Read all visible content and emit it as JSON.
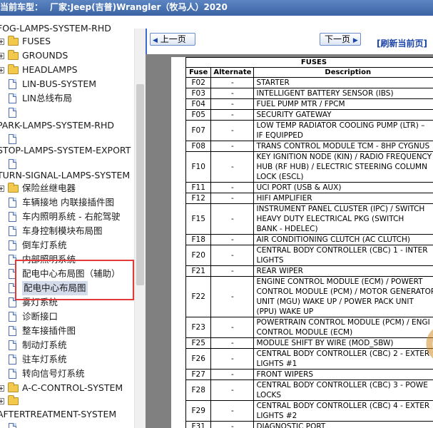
{
  "titlebar": {
    "prefix": "当前车型：",
    "maker": "厂家:Jeep(吉普)Wrangler（牧马人）2020"
  },
  "tree": [
    {
      "label": "FOG-LAMPS-SYSTEM-RHD",
      "type": "text",
      "indent": -2
    },
    {
      "label": "FUSES",
      "type": "folder",
      "indent": 0
    },
    {
      "label": "GROUNDS",
      "type": "folder",
      "indent": 0
    },
    {
      "label": "HEADLAMPS",
      "type": "folder",
      "indent": 0
    },
    {
      "label": "LIN-BUS-SYSTEM",
      "type": "doc",
      "indent": 0
    },
    {
      "label": "LIN总线布局",
      "type": "doc",
      "indent": 0
    },
    {
      "label": "",
      "type": "doc",
      "indent": 0
    },
    {
      "label": "PARK-LAMPS-SYSTEM-RHD",
      "type": "text",
      "indent": -2
    },
    {
      "label": "",
      "type": "doc",
      "indent": 0
    },
    {
      "label": "STOP-LAMPS-SYSTEM-EXPORT",
      "type": "text",
      "indent": -2
    },
    {
      "label": "",
      "type": "doc",
      "indent": 0
    },
    {
      "label": "TURN-SIGNAL-LAMPS-SYSTEM",
      "type": "text",
      "indent": -2
    },
    {
      "label": "保险丝继电器",
      "type": "folder",
      "indent": 0
    },
    {
      "label": "车辆接地 内联接插件图",
      "type": "doc",
      "indent": 0
    },
    {
      "label": "车内照明系统 - 右舵驾驶",
      "type": "doc",
      "indent": 0
    },
    {
      "label": "车身控制模块布局图",
      "type": "doc",
      "indent": 0
    },
    {
      "label": "倒车灯系统",
      "type": "doc",
      "indent": 0
    },
    {
      "label": "内部照明系统",
      "type": "doc",
      "indent": 0
    },
    {
      "label": "配电中心布局图（辅助）",
      "type": "doc",
      "indent": 0
    },
    {
      "label": "配电中心布局图",
      "type": "doc",
      "indent": 0,
      "selected": true
    },
    {
      "label": "雾灯系统",
      "type": "doc",
      "indent": 0
    },
    {
      "label": "诊断接口",
      "type": "doc",
      "indent": 0
    },
    {
      "label": "整车接插件图",
      "type": "doc",
      "indent": 0
    },
    {
      "label": "制动灯系统",
      "type": "doc",
      "indent": 0
    },
    {
      "label": "驻车灯系统",
      "type": "doc",
      "indent": 0
    },
    {
      "label": "转向信号灯系统",
      "type": "doc",
      "indent": 0
    },
    {
      "label": "A-C-CONTROL-SYSTEM",
      "type": "folder",
      "indent": 0
    },
    {
      "label": "",
      "type": "folder",
      "indent": 0
    },
    {
      "label": "AFTERTREATMENT-SYSTEM",
      "type": "text",
      "indent": -2
    },
    {
      "label": "",
      "type": "doc",
      "indent": 0
    }
  ],
  "nav": {
    "prev": "上一页",
    "next": "下一页",
    "refresh": "[刷新当前页]"
  },
  "table": {
    "caption": "FUSES",
    "headers": {
      "fuse": "Fuse",
      "alt": "Alternate",
      "desc": "Description"
    },
    "rows": [
      {
        "fuse": "F02",
        "alt": "-",
        "desc": [
          "STARTER"
        ]
      },
      {
        "fuse": "F03",
        "alt": "-",
        "desc": [
          "INTELLIGENT BATTERY SENSOR (IBS)"
        ]
      },
      {
        "fuse": "F04",
        "alt": "-",
        "desc": [
          "FUEL PUMP MTR / FPCM"
        ]
      },
      {
        "fuse": "F05",
        "alt": "-",
        "desc": [
          "SECURITY GATEWAY"
        ]
      },
      {
        "fuse": "F07",
        "alt": "-",
        "desc": [
          "LOW TEMP RADIATOR COOLING PUMP (LTR) –",
          "IF EQUIPPED"
        ]
      },
      {
        "fuse": "F08",
        "alt": "-",
        "desc": [
          "TRANS CONTROL MODULE TCM - 8HP CYGNUS"
        ]
      },
      {
        "fuse": "F10",
        "alt": "-",
        "desc": [
          "KEY IGNITION NODE (KIN) / RADIO FREQUENCY",
          "HUB (RF HUB) / ELECTRIC STEERING COLUMN",
          "LOCK (ESCL)"
        ]
      },
      {
        "fuse": "F11",
        "alt": "-",
        "desc": [
          "UCI PORT (USB & AUX)"
        ]
      },
      {
        "fuse": "F12",
        "alt": "-",
        "desc": [
          "HIFI AMPLIFIER"
        ]
      },
      {
        "fuse": "F15",
        "alt": "-",
        "desc": [
          "INSTRUMENT PANEL CLUSTER (IPC) / SWITCH",
          "HEAVY DUTY ELECTRICAL PKG (SWITCH",
          "BANK - HDELEC)"
        ]
      },
      {
        "fuse": "F18",
        "alt": "-",
        "desc": [
          "AIR CONDITIONING CLUTCH (AC CLUTCH)"
        ]
      },
      {
        "fuse": "F20",
        "alt": "-",
        "desc": [
          "CENTRAL BODY CONTROLLER (CBC) 1 - INTER",
          "LIGHTS"
        ]
      },
      {
        "fuse": "F21",
        "alt": "-",
        "desc": [
          "REAR WIPER"
        ]
      },
      {
        "fuse": "F22",
        "alt": "-",
        "desc": [
          "ENGINE CONTROL MODULE (ECM) / POWERT",
          "CONTROL MODULE (PCM) / MOTOR GENERATOR",
          "UNIT (MGU) WAKE UP / POWER PACK UNIT",
          "(PPU) WAKE UP"
        ]
      },
      {
        "fuse": "F23",
        "alt": "-",
        "desc": [
          "POWERTRAIN CONTROL MODULE (PCM) / ENGI",
          "CONTROL MODULE (ECM)"
        ]
      },
      {
        "fuse": "F25",
        "alt": "-",
        "desc": [
          "MODULE SHIFT BY WIRE (MOD_SBW)"
        ]
      },
      {
        "fuse": "F26",
        "alt": "-",
        "desc": [
          "CENTRAL BODY CONTROLLER (CBC) 2 - EXTER",
          "LIGHTS #1"
        ]
      },
      {
        "fuse": "F27",
        "alt": "-",
        "desc": [
          "FRONT WIPERS"
        ]
      },
      {
        "fuse": "F28",
        "alt": "-",
        "desc": [
          "CENTRAL BODY CONTROLLER (CBC) 3 - POWE",
          "LOCKS"
        ]
      },
      {
        "fuse": "F29",
        "alt": "-",
        "desc": [
          "CENTRAL BODY CONTROLLER (CBC) 4 - EXTER",
          "LIGHTS #2"
        ]
      },
      {
        "fuse": "F31",
        "alt": "-",
        "desc": [
          "DIAGNOSTIC PORT"
        ]
      }
    ]
  },
  "colors": {
    "title_bg": "#3b63a3",
    "highlight": "#e23a3a",
    "link": "#1b44a8"
  }
}
